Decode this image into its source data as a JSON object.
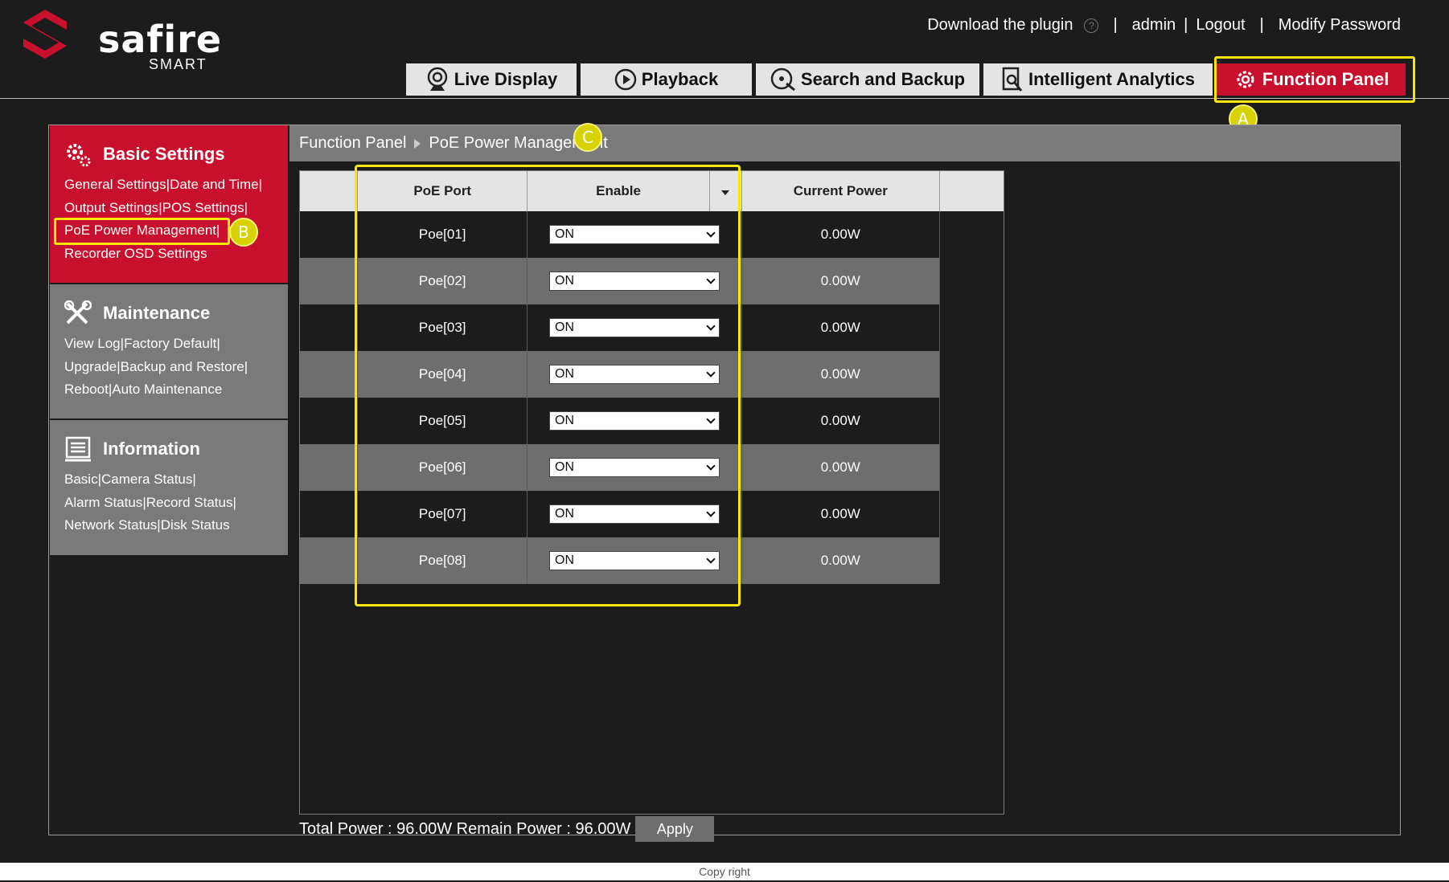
{
  "brand": {
    "name": "safire",
    "sub": "SMART"
  },
  "toplinks": {
    "plugin": "Download the plugin",
    "help": "?",
    "sep": "|",
    "user": "admin",
    "logout": "Logout",
    "modify_password": "Modify Password"
  },
  "tabs": [
    {
      "label": "Live Display",
      "icon": "camera-icon"
    },
    {
      "label": "Playback",
      "icon": "play-icon"
    },
    {
      "label": "Search and Backup",
      "icon": "search-backup-icon"
    },
    {
      "label": "Intelligent Analytics",
      "icon": "analytics-icon"
    },
    {
      "label": "Function Panel",
      "icon": "gear-icon",
      "active": true
    }
  ],
  "badges": {
    "a": "A",
    "b": "B",
    "c": "C"
  },
  "sidebar": {
    "basic": {
      "title": "Basic Settings",
      "links": [
        "General Settings",
        "Date and Time",
        "Output Settings",
        "POS Settings",
        "PoE Power Management",
        "Recorder OSD Settings"
      ]
    },
    "maintenance": {
      "title": "Maintenance",
      "links": [
        "View Log",
        "Factory Default",
        "Upgrade",
        "Backup and Restore",
        "Reboot",
        "Auto Maintenance"
      ]
    },
    "information": {
      "title": "Information",
      "links": [
        "Basic",
        "Camera Status",
        "Alarm Status",
        "Record Status",
        "Network Status",
        "Disk Status"
      ]
    }
  },
  "breadcrumb": {
    "root": "Function Panel",
    "current": "PoE Power Management"
  },
  "table": {
    "headers": {
      "port": "PoE Port",
      "enable": "Enable",
      "power": "Current Power"
    },
    "rows": [
      {
        "port": "Poe[01]",
        "enable": "ON",
        "power": "0.00W"
      },
      {
        "port": "Poe[02]",
        "enable": "ON",
        "power": "0.00W"
      },
      {
        "port": "Poe[03]",
        "enable": "ON",
        "power": "0.00W"
      },
      {
        "port": "Poe[04]",
        "enable": "ON",
        "power": "0.00W"
      },
      {
        "port": "Poe[05]",
        "enable": "ON",
        "power": "0.00W"
      },
      {
        "port": "Poe[06]",
        "enable": "ON",
        "power": "0.00W"
      },
      {
        "port": "Poe[07]",
        "enable": "ON",
        "power": "0.00W"
      },
      {
        "port": "Poe[08]",
        "enable": "ON",
        "power": "0.00W"
      }
    ]
  },
  "summary": {
    "text": "Total Power : 96.00W Remain Power : 96.00W",
    "apply": "Apply"
  },
  "footer": {
    "copyright": "Copy right"
  },
  "colors": {
    "accent": "#c8102e",
    "highlight": "#ffe600",
    "badge": "#d7d200"
  }
}
